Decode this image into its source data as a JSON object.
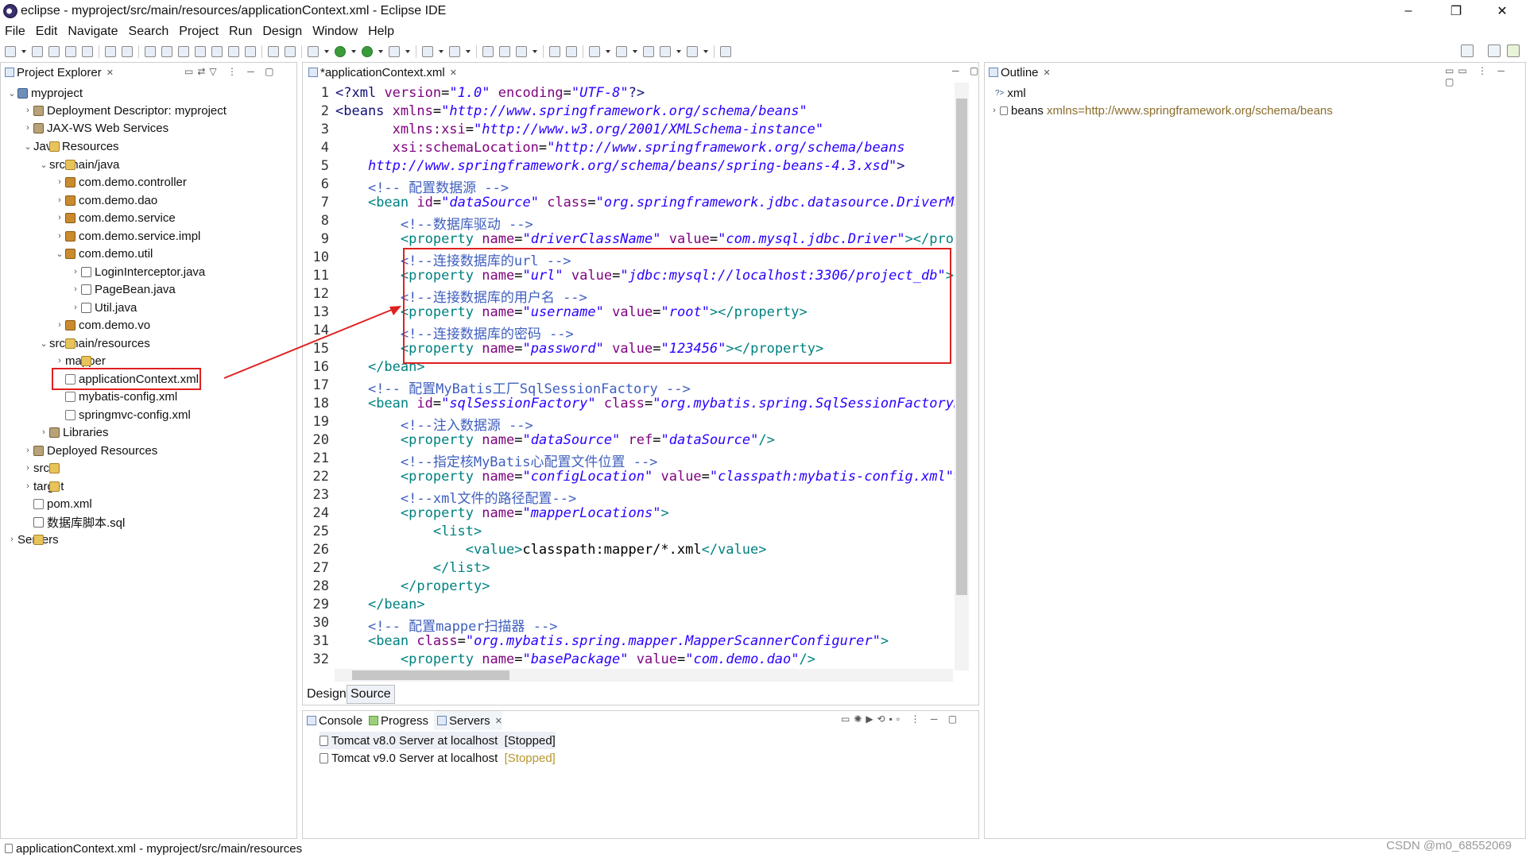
{
  "window": {
    "title": "eclipse - myproject/src/main/resources/applicationContext.xml - Eclipse IDE",
    "minimize": "–",
    "restore": "❐",
    "close": "✕"
  },
  "menu": [
    "File",
    "Edit",
    "Navigate",
    "Search",
    "Project",
    "Run",
    "Design",
    "Window",
    "Help"
  ],
  "project_explorer": {
    "tab": "Project Explorer",
    "close": "✕",
    "tree": [
      {
        "label": "myproject",
        "icon": "project-icon"
      },
      {
        "label": "Deployment Descriptor: myproject",
        "icon": "descriptor-icon"
      },
      {
        "label": "JAX-WS Web Services",
        "icon": "webservice-icon"
      },
      {
        "label": "Java Resources",
        "icon": "java-resources-icon"
      },
      {
        "label": "src/main/java",
        "icon": "source-folder-icon"
      },
      {
        "label": "com.demo.controller",
        "icon": "package-icon"
      },
      {
        "label": "com.demo.dao",
        "icon": "package-icon"
      },
      {
        "label": "com.demo.service",
        "icon": "package-icon"
      },
      {
        "label": "com.demo.service.impl",
        "icon": "package-icon"
      },
      {
        "label": "com.demo.util",
        "icon": "package-icon"
      },
      {
        "label": "LoginInterceptor.java",
        "icon": "java-file-icon"
      },
      {
        "label": "PageBean.java",
        "icon": "java-file-icon"
      },
      {
        "label": "Util.java",
        "icon": "java-file-icon"
      },
      {
        "label": "com.demo.vo",
        "icon": "package-icon"
      },
      {
        "label": "src/main/resources",
        "icon": "source-folder-icon"
      },
      {
        "label": "mapper",
        "icon": "folder-icon"
      },
      {
        "label": "applicationContext.xml",
        "icon": "xml-file-icon"
      },
      {
        "label": "mybatis-config.xml",
        "icon": "xml-file-icon"
      },
      {
        "label": "springmvc-config.xml",
        "icon": "xml-file-icon"
      },
      {
        "label": "Libraries",
        "icon": "library-icon"
      },
      {
        "label": "Deployed Resources",
        "icon": "deployed-icon"
      },
      {
        "label": "src",
        "icon": "folder-icon"
      },
      {
        "label": "target",
        "icon": "folder-icon"
      },
      {
        "label": "pom.xml",
        "icon": "xml-file-icon"
      },
      {
        "label": "数据库脚本.sql",
        "icon": "sql-file-icon"
      },
      {
        "label": "Servers",
        "icon": "folder-icon"
      }
    ]
  },
  "editor": {
    "tab": "*applicationContext.xml",
    "close": "✕",
    "line_numbers": [
      "1",
      "2",
      "3",
      "4",
      "5",
      "6",
      "7",
      "8",
      "9",
      "10",
      "11",
      "12",
      "13",
      "14",
      "15",
      "16",
      "17",
      "18",
      "19",
      "20",
      "21",
      "22",
      "23",
      "24",
      "25",
      "26",
      "27",
      "28",
      "29",
      "30",
      "31",
      "32"
    ],
    "bottom_tabs": [
      "Design",
      "Source"
    ]
  },
  "outline": {
    "tab": "Outline",
    "close": "✕",
    "items": [
      "xml",
      "beans",
      "xmlns=http://www.springframework.org/schema/beans"
    ]
  },
  "console": {
    "tabs": [
      "Console",
      "Progress",
      "Servers"
    ],
    "close": "✕",
    "servers": [
      {
        "name": "Tomcat v8.0 Server at localhost",
        "state": "[Stopped]"
      },
      {
        "name": "Tomcat v9.0 Server at localhost",
        "state": "[Stopped]"
      }
    ]
  },
  "status": {
    "text": "applicationContext.xml - myproject/src/main/resources",
    "watermark": "CSDN @m0_68552069"
  }
}
